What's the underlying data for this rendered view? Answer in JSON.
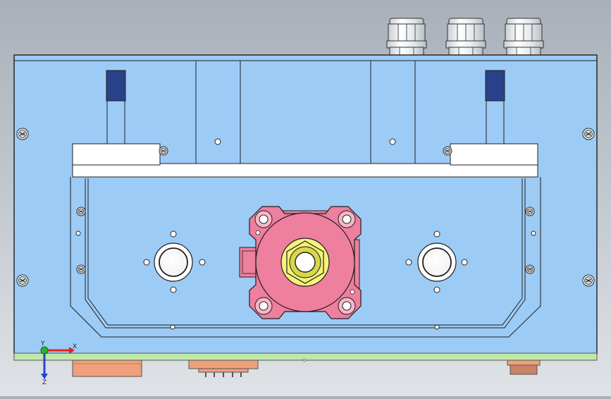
{
  "view": {
    "type": "CAD model front view",
    "background": "#b9c0c8"
  },
  "colors": {
    "housing_face": "#9ccbf5",
    "housing_edge": "#1f1f1f",
    "slide_bar": "#ffffff",
    "pointer_blue": "#27428a",
    "base_strip": "#bfe9a8",
    "base_edge": "#555555",
    "connector_orange": "#f0a07a",
    "connector_brown": "#c98468",
    "flange_pink": "#ee7f9e",
    "flange_pink_light": "#f7b6c8",
    "nut_yellow": "#f4f27a",
    "nut_yellow_dark": "#d9d64a",
    "gland_grey": "#e9ecef"
  },
  "parts": {
    "cable_glands": [
      "cable-gland-1",
      "cable-gland-2",
      "cable-gland-3"
    ],
    "screws": [
      "screw-left-top",
      "screw-left-bottom",
      "screw-right-top",
      "screw-right-bottom"
    ]
  },
  "triad": {
    "x_label": "X",
    "y_label": "Y",
    "z_label": "Z",
    "x_color": "#e8201c",
    "y_color": "#28b428",
    "z_color": "#2a3fd6"
  }
}
